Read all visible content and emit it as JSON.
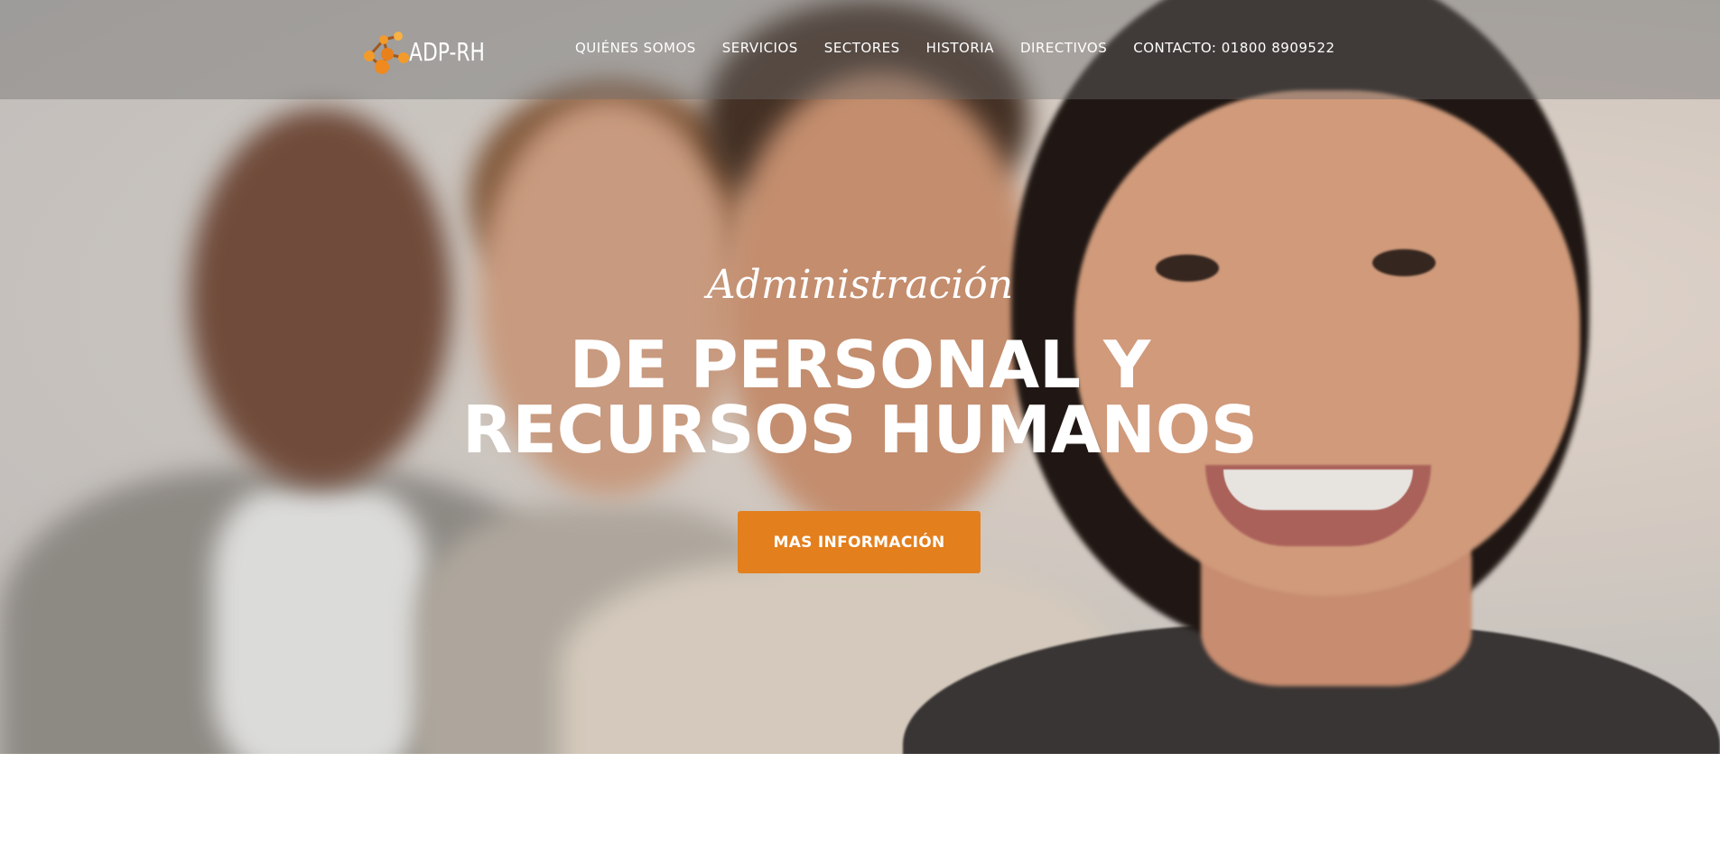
{
  "brand": {
    "name": "ADP-RH",
    "logo_icon": "molecule-icon",
    "accent_color": "#e37f1d"
  },
  "nav": {
    "items": [
      {
        "label": "QUIÉNES SOMOS"
      },
      {
        "label": "SERVICIOS"
      },
      {
        "label": "SECTORES"
      },
      {
        "label": "HISTORIA"
      },
      {
        "label": "DIRECTIVOS"
      },
      {
        "label": "CONTACTO: 01800 8909522"
      }
    ]
  },
  "hero": {
    "subtitle": "Administración",
    "title_line1": "DE PERSONAL Y",
    "title_line2": "RECURSOS HUMANOS",
    "cta_label": "MAS INFORMACIÓN"
  }
}
